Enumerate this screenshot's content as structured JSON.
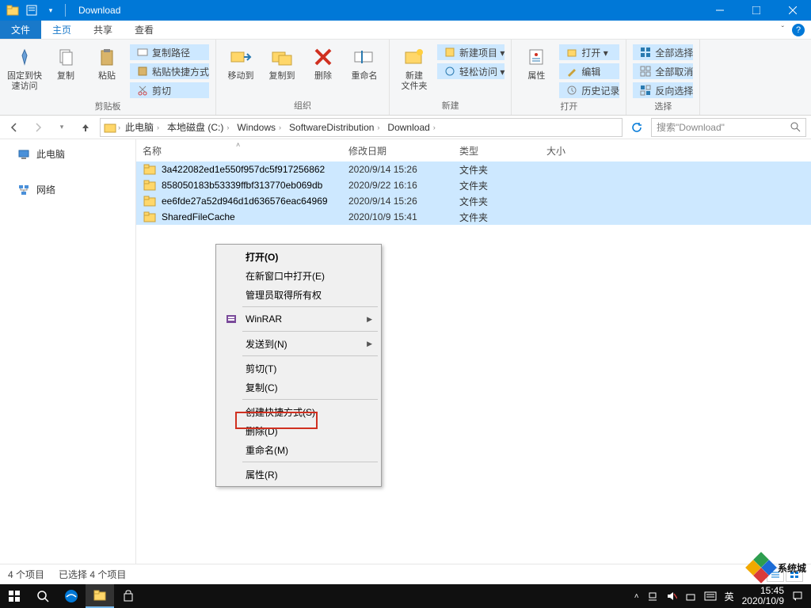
{
  "window": {
    "title": "Download"
  },
  "menubar": {
    "file": "文件",
    "home": "主页",
    "share": "共享",
    "view": "查看"
  },
  "ribbon": {
    "pin": "固定到快\n速访问",
    "copy": "复制",
    "paste": "粘贴",
    "copy_path": "复制路径",
    "paste_shortcut": "粘贴快捷方式",
    "cut": "剪切",
    "grp_clipboard": "剪贴板",
    "move_to": "移动到",
    "copy_to": "复制到",
    "delete": "删除",
    "rename": "重命名",
    "grp_organize": "组织",
    "new_folder": "新建\n文件夹",
    "new_item": "新建项目 ▾",
    "easy_access": "轻松访问 ▾",
    "grp_new": "新建",
    "properties": "属性",
    "open": "打开 ▾",
    "edit": "编辑",
    "history": "历史记录",
    "grp_open": "打开",
    "select_all": "全部选择",
    "select_none": "全部取消",
    "invert_sel": "反向选择",
    "grp_select": "选择"
  },
  "breadcrumb": [
    "此电脑",
    "本地磁盘 (C:)",
    "Windows",
    "SoftwareDistribution",
    "Download"
  ],
  "search_placeholder": "搜索\"Download\"",
  "sidebar": {
    "this_pc": "此电脑",
    "network": "网络"
  },
  "columns": {
    "name": "名称",
    "date": "修改日期",
    "type": "类型",
    "size": "大小"
  },
  "rows": [
    {
      "name": "3a422082ed1e550f957dc5f917256862",
      "date": "2020/9/14 15:26",
      "type": "文件夹"
    },
    {
      "name": "858050183b53339ffbf313770eb069db",
      "date": "2020/9/22 16:16",
      "type": "文件夹"
    },
    {
      "name": "ee6fde27a52d946d1d636576eac64969",
      "date": "2020/9/14 15:26",
      "type": "文件夹"
    },
    {
      "name": "SharedFileCache",
      "date": "2020/10/9 15:41",
      "type": "文件夹"
    }
  ],
  "context_menu": {
    "open": "打开(O)",
    "open_new_window": "在新窗口中打开(E)",
    "take_ownership": "管理员取得所有权",
    "winrar": "WinRAR",
    "send_to": "发送到(N)",
    "cut": "剪切(T)",
    "copy": "复制(C)",
    "create_shortcut": "创建快捷方式(S)",
    "delete": "删除(D)",
    "rename": "重命名(M)",
    "properties": "属性(R)"
  },
  "status": {
    "count": "4 个项目",
    "selected": "已选择 4 个项目"
  },
  "tray": {
    "ime": "英",
    "time": "15:45",
    "date": "2020/10/9"
  },
  "watermark": "系统城"
}
